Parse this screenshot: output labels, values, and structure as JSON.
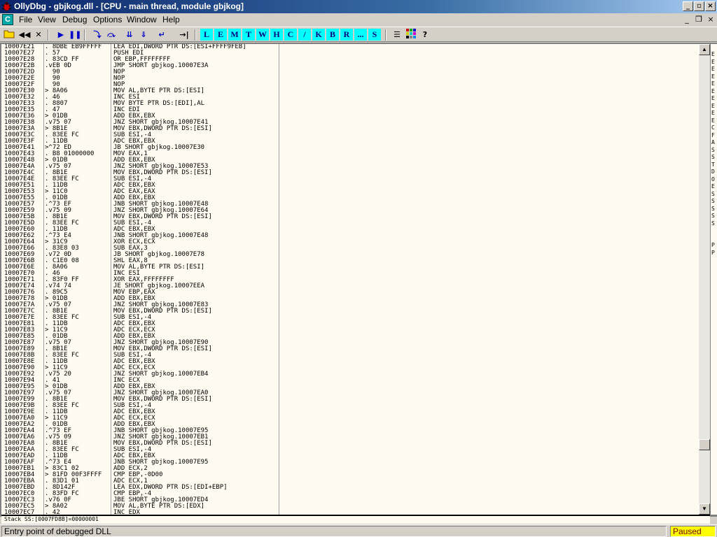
{
  "window": {
    "title": "OllyDbg - gbjkog.dll - [CPU - main thread, module gbjkog]"
  },
  "menu": [
    "File",
    "View",
    "Debug",
    "Options",
    "Window",
    "Help"
  ],
  "mdi_icon_label": "C",
  "toolbar": {
    "letters": [
      "L",
      "E",
      "M",
      "T",
      "W",
      "H",
      "C",
      "/",
      "K",
      "B",
      "R",
      "...",
      "S"
    ]
  },
  "disassembly": [
    {
      "addr": "10007E21",
      "hex": ". 8DBE EB9FFFFF",
      "asm": "LEA EDI,DWORD PTR DS:[ESI+FFFF9FEB]"
    },
    {
      "addr": "10007E27",
      "hex": ". 57",
      "asm": "PUSH EDI"
    },
    {
      "addr": "10007E28",
      "hex": ". 83CD FF",
      "asm": "OR EBP,FFFFFFFF"
    },
    {
      "addr": "10007E2B",
      "hex": ".vEB 0D",
      "asm": "JMP SHORT gbjkog.10007E3A"
    },
    {
      "addr": "10007E2D",
      "hex": "  90",
      "asm": "NOP"
    },
    {
      "addr": "10007E2E",
      "hex": "  90",
      "asm": "NOP"
    },
    {
      "addr": "10007E2F",
      "hex": "  90",
      "asm": "NOP"
    },
    {
      "addr": "10007E30",
      "hex": "> 8A06",
      "asm": "MOV AL,BYTE PTR DS:[ESI]"
    },
    {
      "addr": "10007E32",
      "hex": ". 46",
      "asm": "INC ESI"
    },
    {
      "addr": "10007E33",
      "hex": ". 8807",
      "asm": "MOV BYTE PTR DS:[EDI],AL"
    },
    {
      "addr": "10007E35",
      "hex": ". 47",
      "asm": "INC EDI"
    },
    {
      "addr": "10007E36",
      "hex": "> 01DB",
      "asm": "ADD EBX,EBX"
    },
    {
      "addr": "10007E38",
      "hex": ".v75 07",
      "asm": "JNZ SHORT gbjkog.10007E41"
    },
    {
      "addr": "10007E3A",
      "hex": "> 8B1E",
      "asm": "MOV EBX,DWORD PTR DS:[ESI]"
    },
    {
      "addr": "10007E3C",
      "hex": ". 83EE FC",
      "asm": "SUB ESI,-4"
    },
    {
      "addr": "10007E3F",
      "hex": ". 11DB",
      "asm": "ADC EBX,EBX"
    },
    {
      "addr": "10007E41",
      "hex": ">^72 ED",
      "asm": "JB SHORT gbjkog.10007E30"
    },
    {
      "addr": "10007E43",
      "hex": ". B8 01000000",
      "asm": "MOV EAX,1"
    },
    {
      "addr": "10007E48",
      "hex": "> 01DB",
      "asm": "ADD EBX,EBX"
    },
    {
      "addr": "10007E4A",
      "hex": ".v75 07",
      "asm": "JNZ SHORT gbjkog.10007E53"
    },
    {
      "addr": "10007E4C",
      "hex": ". 8B1E",
      "asm": "MOV EBX,DWORD PTR DS:[ESI]"
    },
    {
      "addr": "10007E4E",
      "hex": ". 83EE FC",
      "asm": "SUB ESI,-4"
    },
    {
      "addr": "10007E51",
      "hex": ". 11DB",
      "asm": "ADC EBX,EBX"
    },
    {
      "addr": "10007E53",
      "hex": "> 11C0",
      "asm": "ADC EAX,EAX"
    },
    {
      "addr": "10007E55",
      "hex": ". 01DB",
      "asm": "ADD EBX,EBX"
    },
    {
      "addr": "10007E57",
      "hex": ".^73 EF",
      "asm": "JNB SHORT gbjkog.10007E48"
    },
    {
      "addr": "10007E59",
      "hex": ".v75 09",
      "asm": "JNZ SHORT gbjkog.10007E64"
    },
    {
      "addr": "10007E5B",
      "hex": ". 8B1E",
      "asm": "MOV EBX,DWORD PTR DS:[ESI]"
    },
    {
      "addr": "10007E5D",
      "hex": ". 83EE FC",
      "asm": "SUB ESI,-4"
    },
    {
      "addr": "10007E60",
      "hex": ". 11DB",
      "asm": "ADC EBX,EBX"
    },
    {
      "addr": "10007E62",
      "hex": ".^73 E4",
      "asm": "JNB SHORT gbjkog.10007E48"
    },
    {
      "addr": "10007E64",
      "hex": "> 31C9",
      "asm": "XOR ECX,ECX"
    },
    {
      "addr": "10007E66",
      "hex": ". 83E8 03",
      "asm": "SUB EAX,3"
    },
    {
      "addr": "10007E69",
      "hex": ".v72 0D",
      "asm": "JB SHORT gbjkog.10007E78"
    },
    {
      "addr": "10007E6B",
      "hex": ". C1E0 08",
      "asm": "SHL EAX,8"
    },
    {
      "addr": "10007E6E",
      "hex": ". 8A06",
      "asm": "MOV AL,BYTE PTR DS:[ESI]"
    },
    {
      "addr": "10007E70",
      "hex": ". 46",
      "asm": "INC ESI"
    },
    {
      "addr": "10007E71",
      "hex": ". 83F0 FF",
      "asm": "XOR EAX,FFFFFFFF"
    },
    {
      "addr": "10007E74",
      "hex": ".v74 74",
      "asm": "JE SHORT gbjkog.10007EEA"
    },
    {
      "addr": "10007E76",
      "hex": ". 89C5",
      "asm": "MOV EBP,EAX"
    },
    {
      "addr": "10007E78",
      "hex": "> 01DB",
      "asm": "ADD EBX,EBX"
    },
    {
      "addr": "10007E7A",
      "hex": ".v75 07",
      "asm": "JNZ SHORT gbjkog.10007E83"
    },
    {
      "addr": "10007E7C",
      "hex": ". 8B1E",
      "asm": "MOV EBX,DWORD PTR DS:[ESI]"
    },
    {
      "addr": "10007E7E",
      "hex": ". 83EE FC",
      "asm": "SUB ESI,-4"
    },
    {
      "addr": "10007E81",
      "hex": ". 11DB",
      "asm": "ADC EBX,EBX"
    },
    {
      "addr": "10007E83",
      "hex": "> 11C9",
      "asm": "ADC ECX,ECX"
    },
    {
      "addr": "10007E85",
      "hex": ". 01DB",
      "asm": "ADD EBX,EBX"
    },
    {
      "addr": "10007E87",
      "hex": ".v75 07",
      "asm": "JNZ SHORT gbjkog.10007E90"
    },
    {
      "addr": "10007E89",
      "hex": ". 8B1E",
      "asm": "MOV EBX,DWORD PTR DS:[ESI]"
    },
    {
      "addr": "10007E8B",
      "hex": ". 83EE FC",
      "asm": "SUB ESI,-4"
    },
    {
      "addr": "10007E8E",
      "hex": ". 11DB",
      "asm": "ADC EBX,EBX"
    },
    {
      "addr": "10007E90",
      "hex": "> 11C9",
      "asm": "ADC ECX,ECX"
    },
    {
      "addr": "10007E92",
      "hex": ".v75 20",
      "asm": "JNZ SHORT gbjkog.10007EB4"
    },
    {
      "addr": "10007E94",
      "hex": ". 41",
      "asm": "INC ECX"
    },
    {
      "addr": "10007E95",
      "hex": "> 01DB",
      "asm": "ADD EBX,EBX"
    },
    {
      "addr": "10007E97",
      "hex": ".v75 07",
      "asm": "JNZ SHORT gbjkog.10007EA0"
    },
    {
      "addr": "10007E99",
      "hex": ". 8B1E",
      "asm": "MOV EBX,DWORD PTR DS:[ESI]"
    },
    {
      "addr": "10007E9B",
      "hex": ". 83EE FC",
      "asm": "SUB ESI,-4"
    },
    {
      "addr": "10007E9E",
      "hex": ". 11DB",
      "asm": "ADC EBX,EBX"
    },
    {
      "addr": "10007EA0",
      "hex": "> 11C9",
      "asm": "ADC ECX,ECX"
    },
    {
      "addr": "10007EA2",
      "hex": ". 01DB",
      "asm": "ADD EBX,EBX"
    },
    {
      "addr": "10007EA4",
      "hex": ".^73 EF",
      "asm": "JNB SHORT gbjkog.10007E95"
    },
    {
      "addr": "10007EA6",
      "hex": ".v75 09",
      "asm": "JNZ SHORT gbjkog.10007EB1"
    },
    {
      "addr": "10007EA8",
      "hex": ". 8B1E",
      "asm": "MOV EBX,DWORD PTR DS:[ESI]"
    },
    {
      "addr": "10007EAA",
      "hex": ". 83EE FC",
      "asm": "SUB ESI,-4"
    },
    {
      "addr": "10007EAD",
      "hex": ". 11DB",
      "asm": "ADC EBX,EBX"
    },
    {
      "addr": "10007EAF",
      "hex": ".^73 E4",
      "asm": "JNB SHORT gbjkog.10007E95"
    },
    {
      "addr": "10007EB1",
      "hex": "> 83C1 02",
      "asm": "ADD ECX,2"
    },
    {
      "addr": "10007EB4",
      "hex": "> 81FD 00F3FFFF",
      "asm": "CMP EBP,-0D00"
    },
    {
      "addr": "10007EBA",
      "hex": ". 83D1 01",
      "asm": "ADC ECX,1"
    },
    {
      "addr": "10007EBD",
      "hex": ". 8D142F",
      "asm": "LEA EDX,DWORD PTR DS:[EDI+EBP]"
    },
    {
      "addr": "10007EC0",
      "hex": ". 83FD FC",
      "asm": "CMP EBP,-4"
    },
    {
      "addr": "10007EC3",
      "hex": ".v76 0F",
      "asm": "JBE SHORT gbjkog.10007ED4"
    },
    {
      "addr": "10007EC5",
      "hex": "> 8A02",
      "asm": "MOV AL,BYTE PTR DS:[EDX]"
    },
    {
      "addr": "10007EC7",
      "hex": ". 42",
      "asm": "INC EDX"
    }
  ],
  "right_pane_letters": [
    "E",
    "E",
    "E",
    "E",
    "E",
    "E",
    "E",
    "E",
    "E",
    "E",
    "C",
    "F",
    "A",
    "S",
    "S",
    "T",
    "D",
    "O",
    "E",
    "S",
    "S",
    "S",
    "S",
    "S",
    "",
    "",
    "P",
    "P"
  ],
  "info_line": "Stack SS:[0007FD8B]=00000001",
  "status": {
    "text": "Entry point of debugged DLL",
    "state": "Paused"
  }
}
